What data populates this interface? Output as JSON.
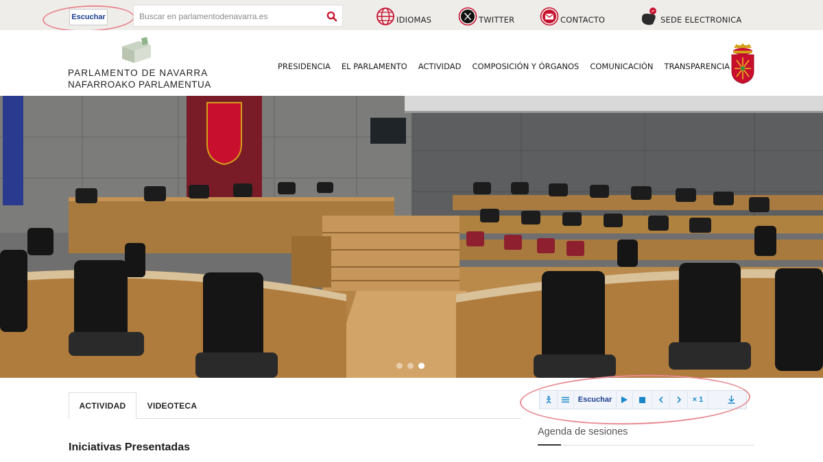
{
  "topbar": {
    "listen_label": "Escuchar",
    "search_placeholder": "Buscar en parlamentodenavarra.es",
    "links": [
      {
        "label": "IDIOMAS",
        "icon": "globe-icon"
      },
      {
        "label": "TWITTER",
        "icon": "x-logo-icon"
      },
      {
        "label": "CONTACTO",
        "icon": "mail-icon"
      },
      {
        "label": "SEDE ELECTRONICA",
        "icon": "cursor-click-icon"
      }
    ]
  },
  "header": {
    "logo_line1": "PARLAMENTO DE NAVARRA",
    "logo_line2": "NAFARROAKO PARLAMENTUA",
    "nav": [
      "PRESIDENCIA",
      "EL PARLAMENTO",
      "ACTIVIDAD",
      "COMPOSICIÓN Y ÓRGANOS",
      "COMUNICACIÓN",
      "TRANSPARENCIA"
    ]
  },
  "hero": {
    "slide_count": 3,
    "active_slide": 3
  },
  "tabs": [
    "ACTIVIDAD",
    "VIDEOTECA"
  ],
  "section_title": "Iniciativas Presentadas",
  "player": {
    "listen_label": "Escuchar",
    "speed_label": "× 1",
    "icons": [
      "accessibility-icon",
      "menu-icon",
      "play-icon",
      "stop-icon",
      "previous-icon",
      "next-icon",
      "download-icon"
    ]
  },
  "agenda_title": "Agenda de sesiones",
  "colors": {
    "accent_red": "#c8102e",
    "player_blue": "#1b87c8",
    "annotation_ring": "#e88a92",
    "topbar_bg": "#efedea"
  }
}
